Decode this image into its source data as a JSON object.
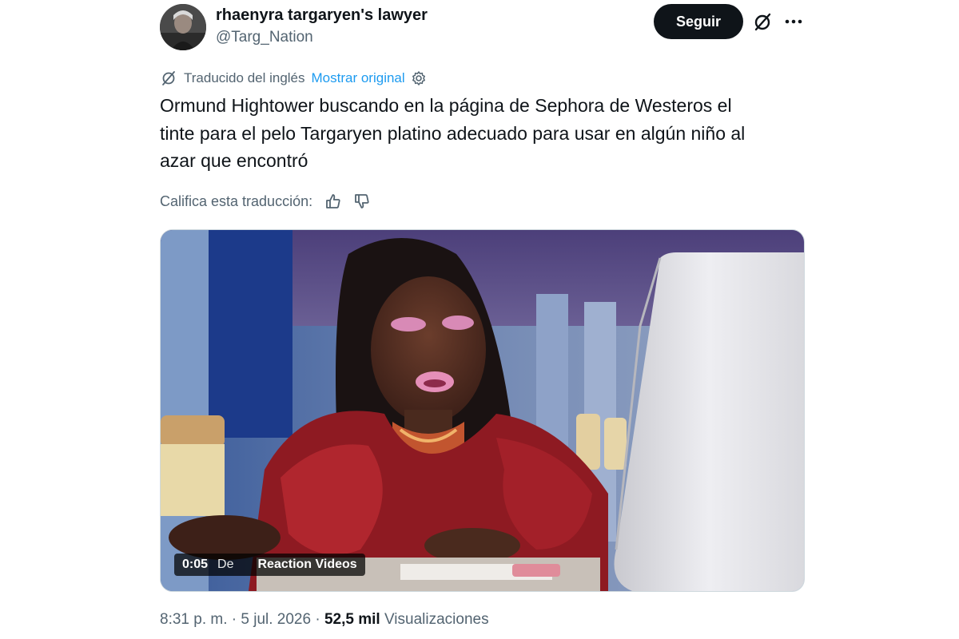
{
  "author": {
    "display_name": "rhaenyra targaryen's lawyer",
    "handle": "@Targ_Nation",
    "avatar_icon": "profile-photo"
  },
  "header": {
    "follow_label": "Seguir",
    "grok_icon": "grok-slash-icon",
    "more_icon": "more-dots-icon"
  },
  "translation": {
    "translated_label": "Traducido del inglés",
    "show_original_label": "Mostrar original",
    "link_color": "#1d9bf0"
  },
  "tweet": {
    "text_lines": [
      "Ormund Hightower buscando en la página de Sephora de Westeros el",
      "tinte para el pelo Targaryen platino adecuado para usar en algún niño al",
      "azar que encontró"
    ]
  },
  "rating": {
    "label": "Califica esta traducción:",
    "up_icon": "thumbs-up-icon",
    "down_icon": "thumbs-down-icon"
  },
  "media": {
    "type": "video",
    "time": "0:05",
    "by_label": "De",
    "source": "Reaction Videos"
  },
  "footer": {
    "time": "8:31 p. m.",
    "separator": "·",
    "date": "5 jul. 2026",
    "views_count": "52,5 mil",
    "views_label": "Visualizaciones"
  }
}
